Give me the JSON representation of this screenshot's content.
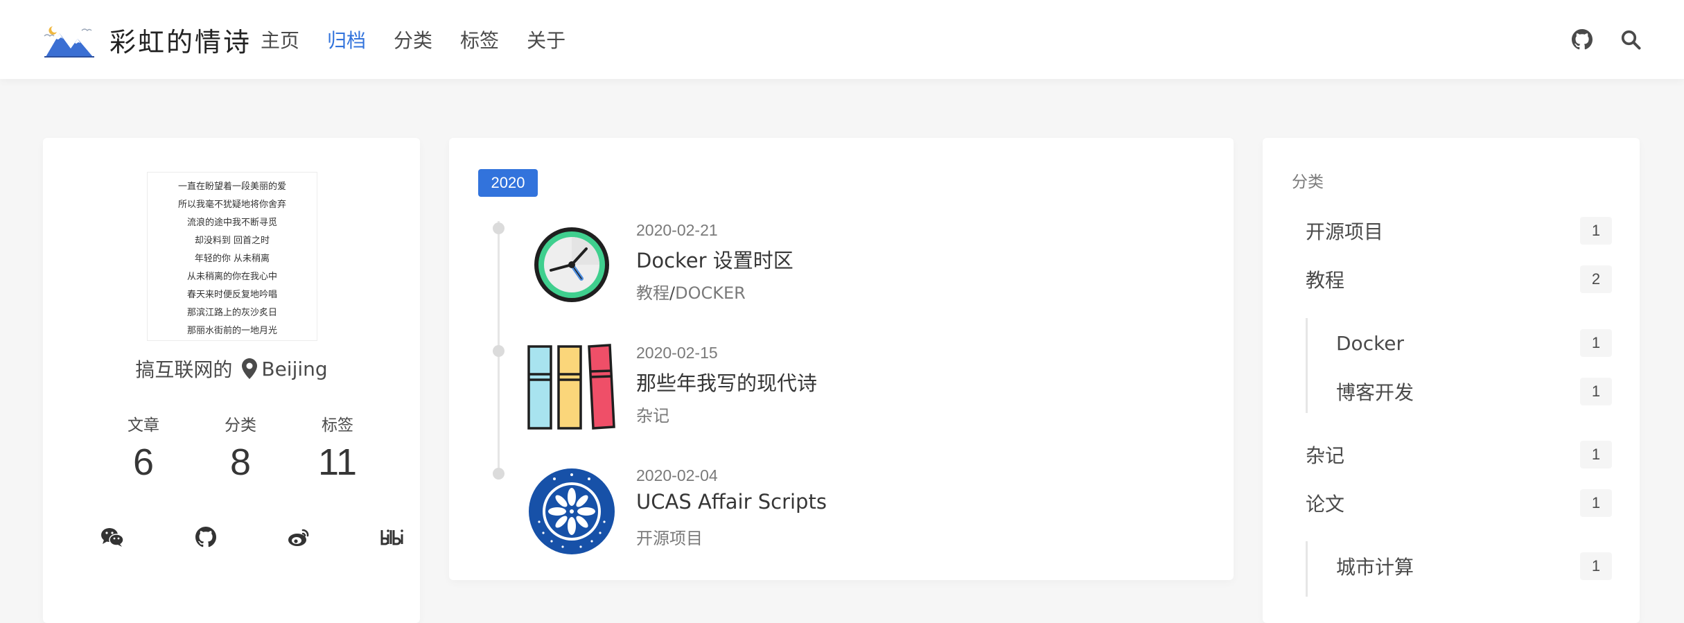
{
  "site": {
    "title": "彩虹的情诗"
  },
  "nav": {
    "items": [
      "主页",
      "归档",
      "分类",
      "标签",
      "关于"
    ],
    "active_index": 1
  },
  "profile": {
    "poem": [
      "一直在盼望着一段美丽的爱",
      "所以我毫不犹疑地将你舍弃",
      "流浪的途中我不断寻觅",
      "却没料到 回首之时",
      "年轻的你 从未稍离",
      "从未稍离的你在我心中",
      "春天来时便反复地吟唱",
      "那滨江路上的灰沙炙日",
      "那丽水街前的一地月光"
    ],
    "author": "搞互联网的",
    "location": "Beijing",
    "stats": [
      {
        "label": "文章",
        "value": "6"
      },
      {
        "label": "分类",
        "value": "8"
      },
      {
        "label": "标签",
        "value": "11"
      }
    ]
  },
  "archive": {
    "year": "2020",
    "posts": [
      {
        "date": "2020-02-21",
        "title": "Docker 设置时区",
        "categories": [
          "教程",
          "DOCKER"
        ]
      },
      {
        "date": "2020-02-15",
        "title": "那些年我写的现代诗",
        "categories": [
          "杂记"
        ]
      },
      {
        "date": "2020-02-04",
        "title": "UCAS Affair Scripts",
        "categories": [
          "开源项目"
        ]
      }
    ]
  },
  "categories": {
    "heading": "分类",
    "items": [
      {
        "name": "开源项目",
        "count": "1"
      },
      {
        "name": "教程",
        "count": "2"
      },
      {
        "name": "Docker",
        "count": "1"
      },
      {
        "name": "博客开发",
        "count": "1"
      },
      {
        "name": "杂记",
        "count": "1"
      },
      {
        "name": "论文",
        "count": "1"
      },
      {
        "name": "城市计算",
        "count": "1"
      }
    ]
  },
  "colors": {
    "accent": "#3273dc",
    "background": "#f6f6f6",
    "card": "#ffffff"
  }
}
